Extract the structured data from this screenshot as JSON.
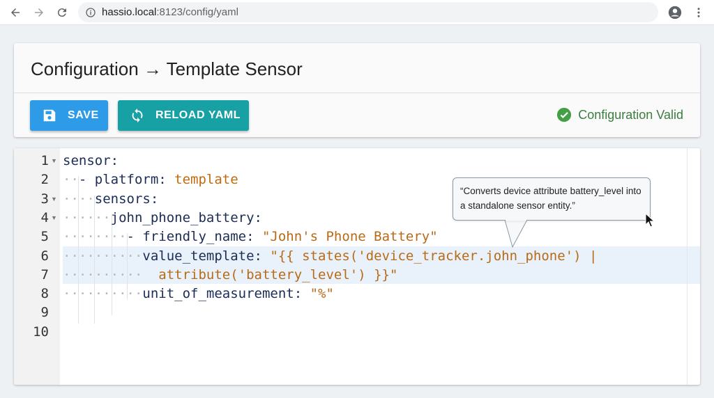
{
  "browser": {
    "url_host": "hassio.local",
    "url_path": ":8123/config/yaml"
  },
  "header": {
    "breadcrumb": "Configuration → Template Sensor"
  },
  "toolbar": {
    "save_label": "SAVE",
    "reload_label": "RELOAD YAML",
    "status_text": "Configuration Valid"
  },
  "editor": {
    "line_numbers": [
      "1",
      "2",
      "3",
      "4",
      "5",
      "6",
      "7",
      "8",
      "9",
      "10"
    ],
    "lines": [
      {
        "indent": "",
        "tokens": [
          {
            "t": "sensor:",
            "c": "key"
          }
        ]
      },
      {
        "indent": "··",
        "tokens": [
          {
            "t": "- platform: ",
            "c": "key"
          },
          {
            "t": "template",
            "c": "val"
          }
        ]
      },
      {
        "indent": "····",
        "tokens": [
          {
            "t": "sensors:",
            "c": "key"
          }
        ]
      },
      {
        "indent": "······",
        "tokens": [
          {
            "t": "john_phone_battery:",
            "c": "key"
          }
        ]
      },
      {
        "indent": "········",
        "tokens": [
          {
            "t": "- friendly_name: ",
            "c": "key"
          },
          {
            "t": "\"John's Phone Battery\"",
            "c": "str"
          }
        ]
      },
      {
        "indent": "··········",
        "tokens": [
          {
            "t": "value_template: ",
            "c": "key"
          },
          {
            "t": "\"{{ states('device_tracker.john_phone') |",
            "c": "str"
          }
        ]
      },
      {
        "indent": "··········",
        "tokens": [
          {
            "t": "  attribute('battery_level') }}\"",
            "c": "str"
          }
        ]
      },
      {
        "indent": "··········",
        "tokens": [
          {
            "t": "unit_of_measurement: ",
            "c": "key"
          },
          {
            "t": "\"%\"",
            "c": "str"
          }
        ]
      },
      {
        "indent": "",
        "tokens": []
      },
      {
        "indent": "",
        "tokens": []
      }
    ]
  },
  "tooltip": {
    "text": "“Converts device attribute battery_level into a standalone sensor entity.”"
  },
  "colors": {
    "save_button": "#2d9be8",
    "reload_button": "#17a1a5",
    "valid_status": "#3a7d3e",
    "string_token": "#b86a16"
  },
  "icons": [
    "back-arrow-icon",
    "forward-arrow-icon",
    "reload-icon",
    "info-icon",
    "account-icon",
    "more-vert-icon",
    "save-icon",
    "sync-icon",
    "check-circle-icon",
    "pointer-cursor-icon"
  ]
}
